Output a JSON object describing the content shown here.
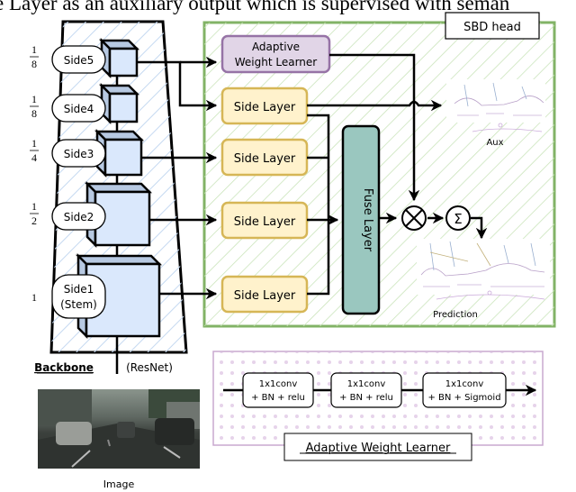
{
  "header": {
    "caption_fragment": "e Layer as an auxiliary output which is supervised with seman"
  },
  "backbone": {
    "title": "Backbone",
    "subtitle": "(ResNet)",
    "stages": [
      {
        "label": "Side5",
        "scale_num": "1",
        "scale_den": "8"
      },
      {
        "label": "Side4",
        "scale_num": "1",
        "scale_den": "8"
      },
      {
        "label": "Side3",
        "scale_num": "1",
        "scale_den": "4"
      },
      {
        "label": "Side2",
        "scale_num": "1",
        "scale_den": "2"
      },
      {
        "label_line1": "Side1",
        "label_line2": "(Stem)",
        "scale": "1"
      }
    ],
    "input_image_label": "Image"
  },
  "sbd_head": {
    "title": "SBD head",
    "adaptive_weight_learner_line1": "Adaptive",
    "adaptive_weight_learner_line2": "Weight Learner",
    "side_layers": [
      "Side Layer",
      "Side Layer",
      "Side Layer",
      "Side Layer"
    ],
    "fuse_layer": "Fuse Layer",
    "multiply_symbol": "⊗",
    "sum_symbol": "Σ",
    "aux_label": "Aux",
    "prediction_label": "Prediction"
  },
  "awl_detail": {
    "title": "Adaptive Weight Learner",
    "blocks": [
      {
        "line1": "1x1conv",
        "line2": "+ BN + relu"
      },
      {
        "line1": "1x1conv",
        "line2": "+ BN + relu"
      },
      {
        "line1": "1x1conv",
        "line2": "+ BN + Sigmoid"
      }
    ]
  },
  "colors": {
    "head_border": "#82b366",
    "head_hatch": "#c8e3b8",
    "backbone_hatch": "#c5d9f1",
    "cube_fill": "#dae8fc",
    "cube_side": "#b7c9e2",
    "awl_fill": "#e1d5e7",
    "awl_border": "#9673a6",
    "side_layer_fill": "#fff2cc",
    "side_layer_border": "#d6b656",
    "fuse_fill": "#9ac7bf",
    "awl_detail_border": "#c9a8cf",
    "awl_dots": "#e6d3ea"
  }
}
